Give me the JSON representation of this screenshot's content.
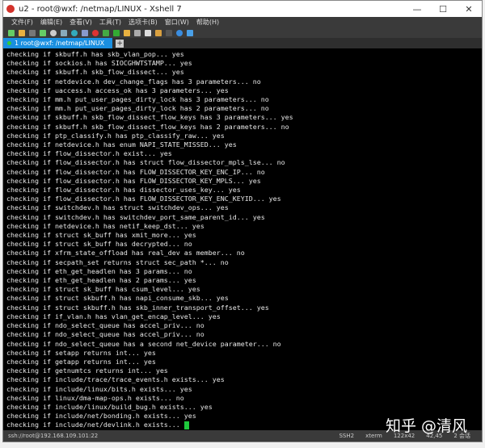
{
  "window": {
    "title": "u2 - root@wxf: /netmap/LINUX - Xshell 7"
  },
  "menu": [
    "文件(F)",
    "编辑(E)",
    "查看(V)",
    "工具(T)",
    "选项卡(B)",
    "窗口(W)",
    "帮助(H)"
  ],
  "tab": {
    "label": "1 root@wxf: /netmap/LINUX",
    "add": "+"
  },
  "terminal": {
    "lines": [
      "checking if skbuff.h has skb_vlan_pop... yes",
      "checking if sockios.h has SIOCGHWTSTAMP... yes",
      "checking if skbuff.h skb_flow_dissect... yes",
      "checking if netdevice.h dev_change_flags has 3 parameters... no",
      "checking if uaccess.h access_ok has 3 parameters... yes",
      "checking if mm.h put_user_pages_dirty_lock has 3 parameters... no",
      "checking if mm.h put_user_pages_dirty_lock has 2 parameters... no",
      "checking if skbuff.h skb_flow_dissect_flow_keys has 3 parameters... yes",
      "checking if skbuff.h skb_flow_dissect_flow_keys has 2 parameters... no",
      "checking if ptp_classify.h has ptp_classify_raw... yes",
      "checking if netdevice.h has enum NAPI_STATE_MISSED... yes",
      "checking if flow_dissector.h exist... yes",
      "checking if flow_dissector.h has struct flow_dissector_mpls_lse... no",
      "checking if flow_dissector.h has FLOW_DISSECTOR_KEY_ENC_IP... no",
      "checking if flow_dissector.h has FLOW_DISSECTOR_KEY_MPLS... yes",
      "checking if flow_dissector.h has dissector_uses_key... yes",
      "checking if flow_dissector.h has FLOW_DISSECTOR_KEY_ENC_KEYID... yes",
      "checking if switchdev.h has struct switchdev_ops... yes",
      "checking if switchdev.h has switchdev_port_same_parent_id... yes",
      "checking if netdevice.h has netif_keep_dst... yes",
      "checking if struct sk_buff has xmit_more... yes",
      "checking if struct sk_buff has decrypted... no",
      "checking if xfrm_state_offload has real_dev as member... no",
      "checking if secpath_set returns struct sec_path *... no",
      "checking if eth_get_headlen has 3 params... no",
      "checking if eth_get_headlen has 2 params... yes",
      "checking if struct sk_buff has csum_level... yes",
      "checking if struct skbuff.h has napi_consume_skb... yes",
      "checking if struct skbuff.h has skb_inner_transport_offset... yes",
      "checking if if_vlan.h has vlan_get_encap_level... yes",
      "checking if ndo_select_queue has accel_priv... no",
      "checking if ndo_select_queue has accel_priv... no",
      "checking if ndo_select_queue has a second net_device parameter... no",
      "checking if setapp returns int... yes",
      "checking if getapp returns int... yes",
      "checking if getnumtcs returns int... yes",
      "checking if include/trace/trace_events.h exists... yes",
      "checking if include/linux/bits.h exists... yes",
      "checking if linux/dma-map-ops.h exists... no",
      "checking if include/linux/build_bug.h exists... yes",
      "checking if include/net/bonding.h exists... yes",
      "checking if include/net/devlink.h exists... "
    ]
  },
  "status": {
    "connection": "ssh://root@192.168.109.101:22",
    "protocol": "SSH2",
    "term": "xterm",
    "size": "122x42",
    "cursor": "42,45",
    "sessions": "2 会话"
  },
  "watermark": "知乎 @清风",
  "colors": {
    "tab": "#1a8fe0",
    "cursor": "#1ec83c",
    "terminal_bg": "#000000"
  }
}
